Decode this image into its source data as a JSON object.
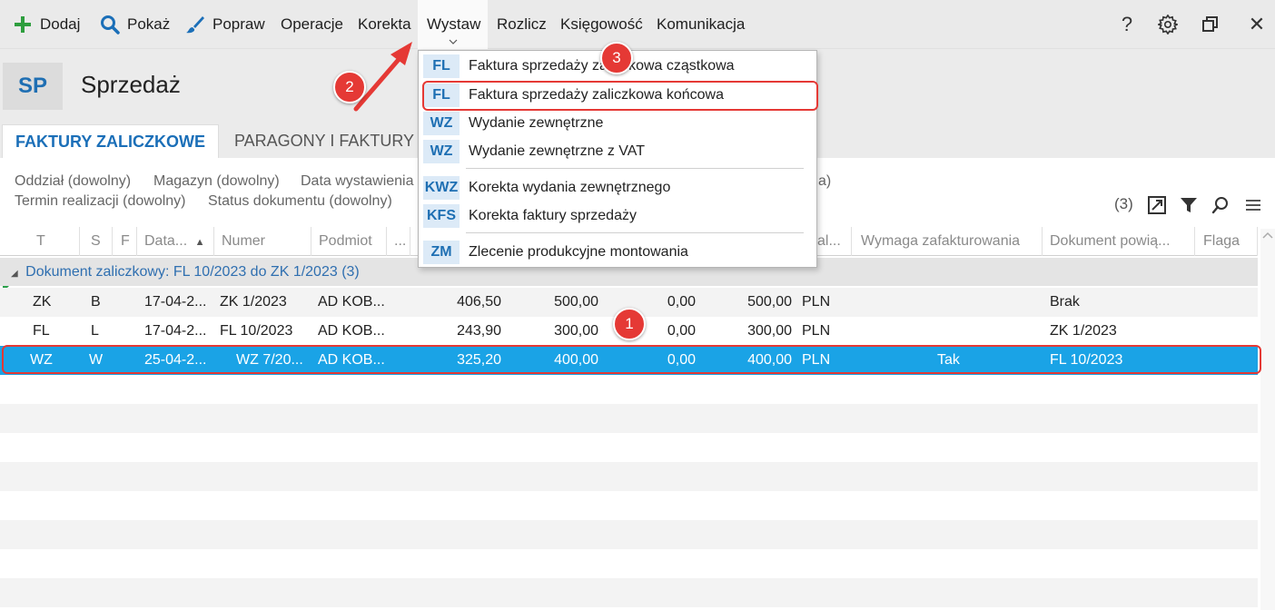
{
  "toolbar": {
    "items": [
      {
        "label": "Dodaj",
        "icon": "plus-icon"
      },
      {
        "label": "Pokaż",
        "icon": "search-icon"
      },
      {
        "label": "Popraw",
        "icon": "brush-icon"
      },
      {
        "label": "Operacje"
      },
      {
        "label": "Korekta"
      },
      {
        "label": "Wystaw"
      },
      {
        "label": "Rozlicz"
      },
      {
        "label": "Księgowość"
      },
      {
        "label": "Komunikacja"
      }
    ],
    "right_icons": [
      "help-icon",
      "gear-icon",
      "restore-window-icon",
      "close-icon"
    ],
    "help_glyph": "?",
    "close_glyph": "✕"
  },
  "module": {
    "badge": "SP",
    "title": "Sprzedaż"
  },
  "tabs": [
    {
      "label": "FAKTURY ZALICZKOWE",
      "active": true
    },
    {
      "label": "PARAGONY I FAKTURY"
    }
  ],
  "filters": {
    "row1": [
      "Oddział (dowolny)",
      "Magazyn (dowolny)",
      "Data wystawienia"
    ],
    "row1_tail": "a)",
    "row2": [
      "Termin realizacji (dowolny)",
      "Status dokumentu (dowolny)"
    ]
  },
  "grid": {
    "count": "(3)",
    "columns": [
      "T",
      "S",
      "F",
      "Data...",
      "Numer",
      "Podmiot",
      "...",
      "al...",
      "Wymaga zafakturowania",
      "Dokument powią...",
      "Flaga"
    ],
    "group_label": "Dokument zaliczkowy: FL 10/2023 do ZK 1/2023 (3)",
    "rows": [
      {
        "t": "ZK",
        "s": "B",
        "data": "17-04-2...",
        "numer": "ZK 1/2023",
        "podmiot": "AD KOB...",
        "v1": "406,50",
        "v2": "500,00",
        "v3": "0,00",
        "v4": "500,00",
        "waluta": "PLN",
        "wymaga": "",
        "dokument": "Brak"
      },
      {
        "t": "FL",
        "s": "L",
        "data": "17-04-2...",
        "numer": "FL 10/2023",
        "podmiot": "AD KOB...",
        "v1": "243,90",
        "v2": "300,00",
        "v3": "0,00",
        "v4": "300,00",
        "waluta": "PLN",
        "wymaga": "",
        "dokument": "ZK 1/2023"
      },
      {
        "t": "WZ",
        "s": "W",
        "data": "25-04-2...",
        "numer": "WZ 7/20...",
        "podmiot": "AD KOB...",
        "v1": "325,20",
        "v2": "400,00",
        "v3": "0,00",
        "v4": "400,00",
        "waluta": "PLN",
        "wymaga": "Tak",
        "dokument": "FL 10/2023",
        "selected": true
      }
    ]
  },
  "dropdown": {
    "items": [
      {
        "code": "FL",
        "label": "Faktura sprzedaży zaliczkowa cząstkowa"
      },
      {
        "code": "FL",
        "label": "Faktura sprzedaży zaliczkowa końcowa",
        "highlighted": true
      },
      {
        "code": "WZ",
        "label": "Wydanie zewnętrzne"
      },
      {
        "code": "WZ",
        "label": "Wydanie zewnętrzne z VAT"
      },
      {
        "code": "KWZ",
        "label": "Korekta wydania zewnętrznego"
      },
      {
        "code": "KFS",
        "label": "Korekta faktury sprzedaży"
      },
      {
        "code": "ZM",
        "label": "Zlecenie produkcyjne montowania"
      }
    ]
  },
  "annotations": {
    "step1": "1",
    "step2": "2",
    "step3": "3"
  },
  "colors": {
    "accent": "#1b6fb8",
    "selection": "#1aa3e6",
    "annotation": "#e53935"
  }
}
